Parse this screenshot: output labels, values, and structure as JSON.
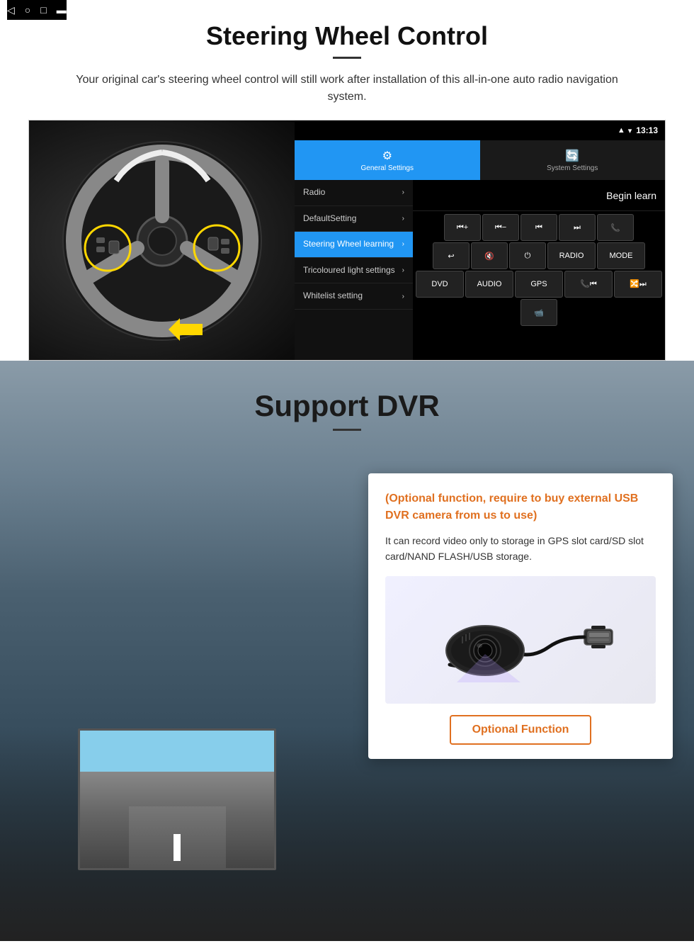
{
  "page": {
    "steering_section": {
      "title": "Steering Wheel Control",
      "description": "Your original car's steering wheel control will still work after installation of this all-in-one auto radio navigation system.",
      "status_time": "13:13",
      "tabs": [
        {
          "id": "general",
          "label": "General Settings",
          "icon": "⚙",
          "active": true
        },
        {
          "id": "system",
          "label": "System Settings",
          "icon": "🔄",
          "active": false
        }
      ],
      "menu_items": [
        {
          "label": "Radio",
          "active": false
        },
        {
          "label": "DefaultSetting",
          "active": false
        },
        {
          "label": "Steering Wheel learning",
          "active": true
        },
        {
          "label": "Tricoloured light settings",
          "active": false
        },
        {
          "label": "Whitelist setting",
          "active": false
        }
      ],
      "begin_learn_label": "Begin learn",
      "control_buttons": [
        [
          "⏮+",
          "⏮-",
          "⏮⏮",
          "⏭⏭",
          "📞"
        ],
        [
          "↩",
          "🔇",
          "⏻",
          "RADIO",
          "MODE"
        ],
        [
          "DVD",
          "AUDIO",
          "GPS",
          "📞⏮",
          "🔀⏭"
        ],
        [
          "📹"
        ]
      ]
    },
    "dvr_section": {
      "title": "Support DVR",
      "optional_text": "(Optional function, require to buy external USB DVR camera from us to use)",
      "description": "It can record video only to storage in GPS slot card/SD slot card/NAND FLASH/USB storage.",
      "optional_function_label": "Optional Function"
    }
  }
}
